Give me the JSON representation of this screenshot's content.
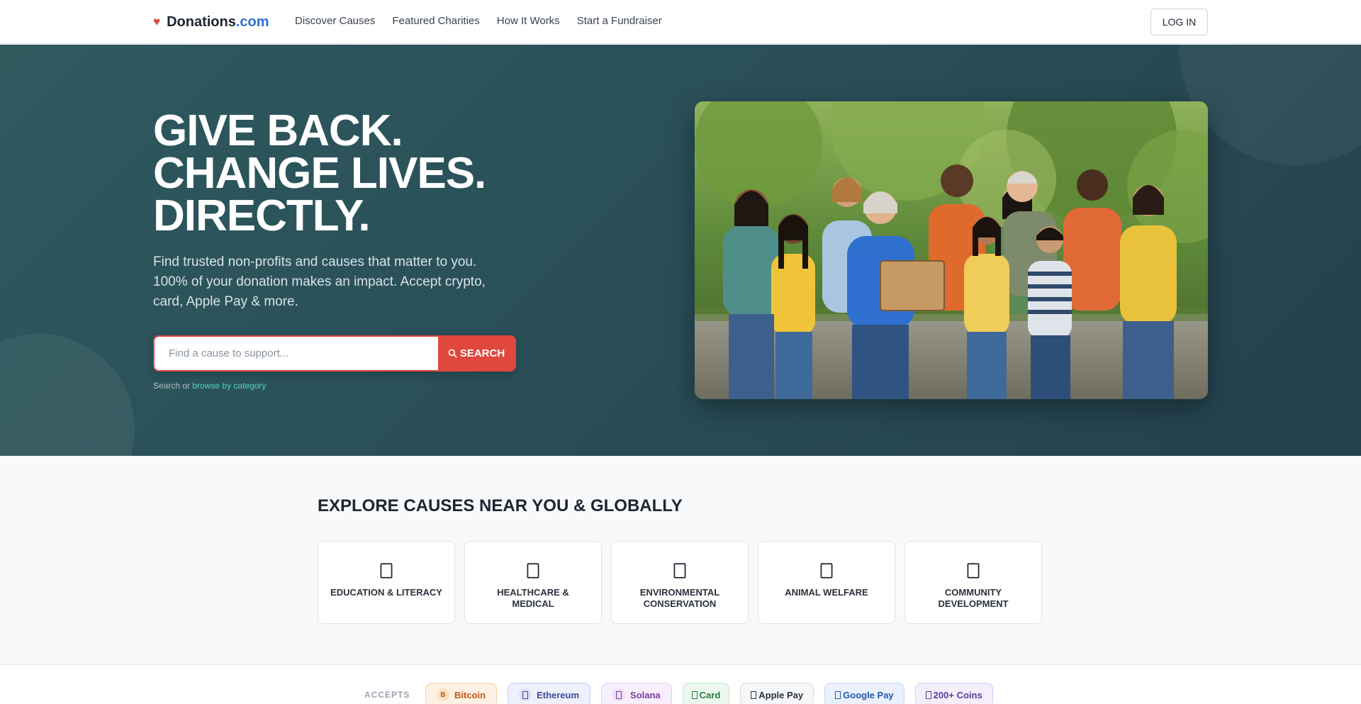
{
  "nav": {
    "logo_name": "Donations",
    "logo_tld": ".com",
    "links": [
      "Discover Causes",
      "Featured Charities",
      "How It Works",
      "Start a Fundraiser"
    ],
    "login_label": "LOG IN"
  },
  "hero": {
    "headline": [
      "GIVE BACK.",
      "CHANGE LIVES.",
      "DIRECTLY."
    ],
    "subtitle": "Find trusted non-profits and causes that matter to you. 100% of your donation makes an impact. Accept crypto, card, Apple Pay & more.",
    "search_placeholder": "Find a cause to support...",
    "search_button": "SEARCH",
    "hint_prefix": "Search or",
    "hint_link": "browse by category"
  },
  "explore": {
    "title": "EXPLORE CAUSES NEAR YOU & GLOBALLY",
    "categories": [
      {
        "label": "EDUCATION & LITERACY",
        "icon": "book-icon"
      },
      {
        "label": "HEALTHCARE & MEDICAL",
        "icon": "medical-icon"
      },
      {
        "label": "ENVIRONMENTAL CONSERVATION",
        "icon": "leaf-icon"
      },
      {
        "label": "ANIMAL WELFARE",
        "icon": "paw-icon"
      },
      {
        "label": "COMMUNITY DEVELOPMENT",
        "icon": "people-icon"
      }
    ]
  },
  "accepts": {
    "label": "ACCEPTS",
    "methods": [
      {
        "label": "Bitcoin",
        "icon": "bitcoin-icon",
        "badge": "B"
      },
      {
        "label": "Ethereum",
        "icon": "ethereum-icon"
      },
      {
        "label": "Solana",
        "icon": "solana-icon"
      },
      {
        "label": "Card",
        "icon": "card-icon"
      },
      {
        "label": "Apple Pay",
        "icon": "apple-icon"
      },
      {
        "label": "Google Pay",
        "icon": "google-icon"
      },
      {
        "label": "200+ Coins",
        "icon": "coins-icon"
      }
    ]
  },
  "colors": {
    "accent": "#e0483d",
    "brand_blue": "#2f6fd0",
    "hero_bg": "#2a4f58",
    "link_teal": "#4fd6c2"
  }
}
